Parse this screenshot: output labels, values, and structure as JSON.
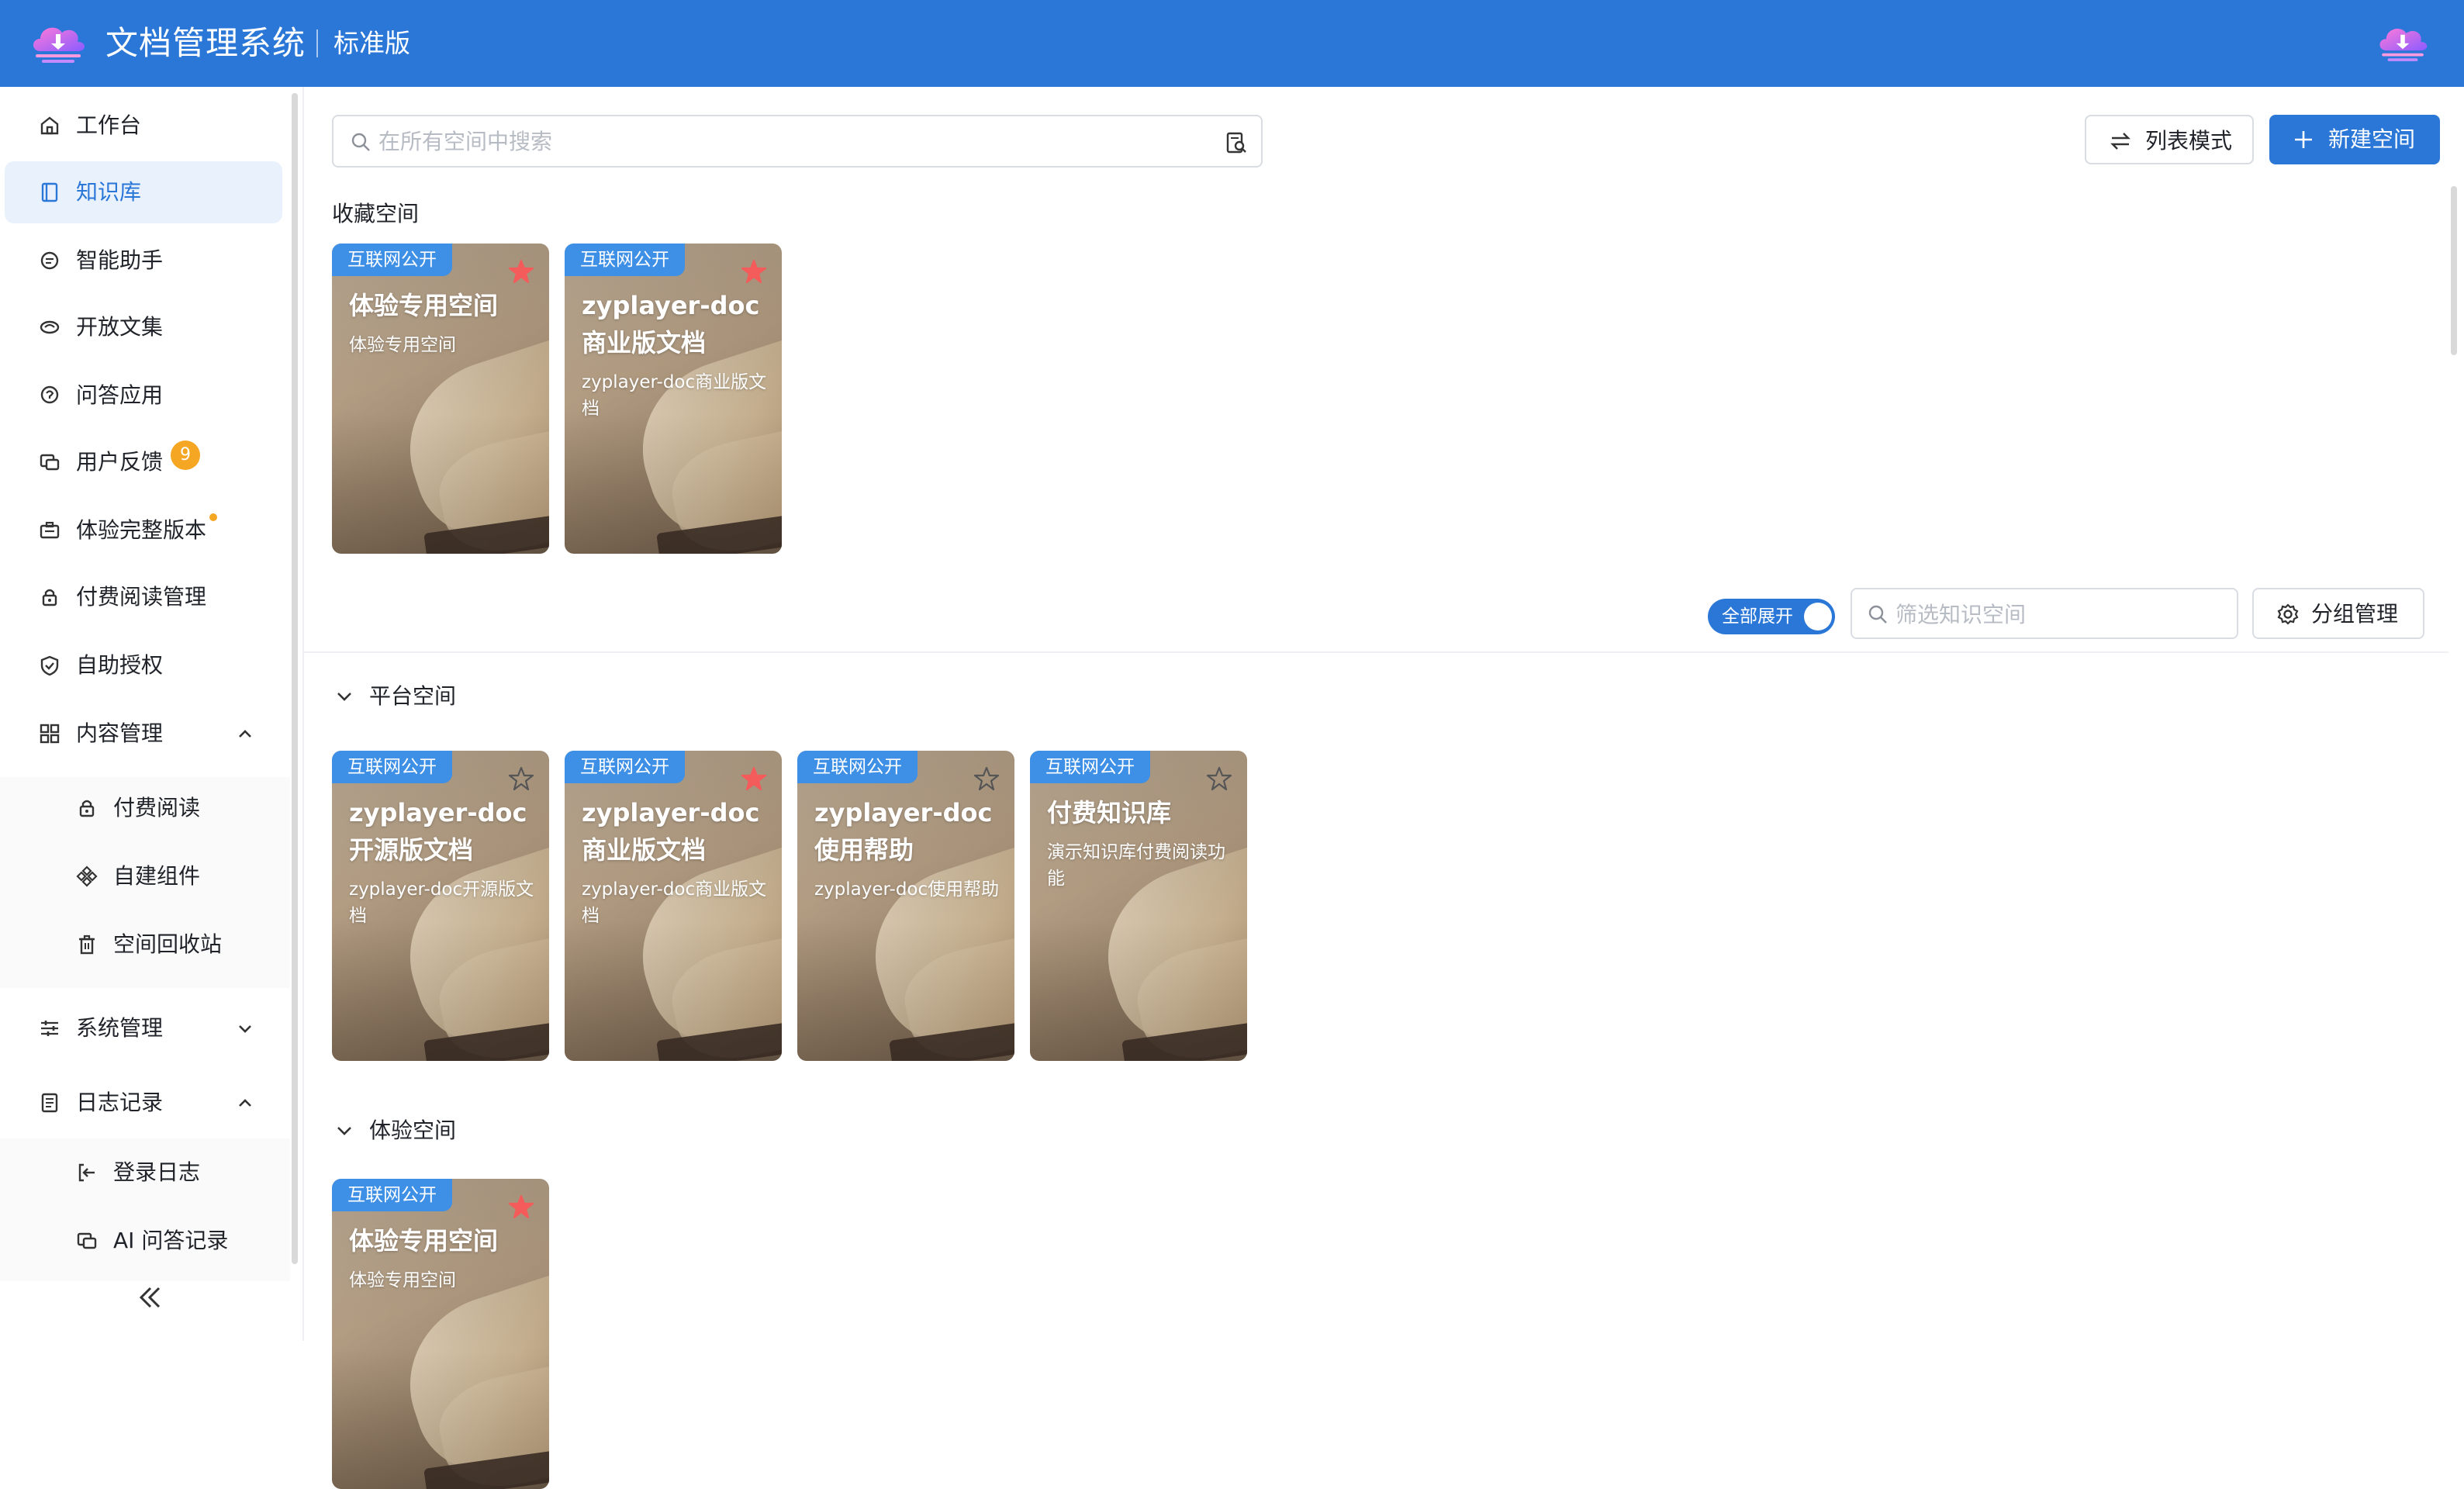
{
  "header": {
    "title": "文档管理系统",
    "edition": "标准版"
  },
  "sidebar": {
    "items": [
      {
        "label": "工作台",
        "icon": "home-icon"
      },
      {
        "label": "知识库",
        "icon": "book-icon"
      },
      {
        "label": "智能助手",
        "icon": "chat-icon"
      },
      {
        "label": "开放文集",
        "icon": "open-collection-icon"
      },
      {
        "label": "问答应用",
        "icon": "qa-icon"
      },
      {
        "label": "用户反馈",
        "icon": "feedback-icon",
        "badge": "9"
      },
      {
        "label": "体验完整版本",
        "icon": "briefcase-icon"
      },
      {
        "label": "付费阅读管理",
        "icon": "lock-icon"
      },
      {
        "label": "自助授权",
        "icon": "shield-icon"
      },
      {
        "label": "内容管理",
        "icon": "grid-icon"
      },
      {
        "label": "系统管理",
        "icon": "sliders-icon"
      },
      {
        "label": "日志记录",
        "icon": "log-icon"
      }
    ],
    "content_sub": [
      {
        "label": "付费阅读",
        "icon": "lock-icon"
      },
      {
        "label": "自建组件",
        "icon": "component-icon"
      },
      {
        "label": "空间回收站",
        "icon": "trash-icon"
      }
    ],
    "log_sub": [
      {
        "label": "登录日志",
        "icon": "login-icon"
      },
      {
        "label": "AI 问答记录",
        "icon": "ai-chat-icon"
      }
    ]
  },
  "toolbar": {
    "search_placeholder": "在所有空间中搜索",
    "list_mode_label": "列表模式",
    "new_space_label": "新建空间"
  },
  "favorites": {
    "title": "收藏空间",
    "cards": [
      {
        "tag": "互联网公开",
        "title": "体验专用空间",
        "desc": "体验专用空间",
        "starred": true
      },
      {
        "tag": "互联网公开",
        "title": "zyplayer-doc商业版文档",
        "desc": "zyplayer-doc商业版文档",
        "starred": true
      }
    ]
  },
  "filters": {
    "expand_all_label": "全部展开",
    "expand_all_on": true,
    "filter_placeholder": "筛选知识空间",
    "group_manage_label": "分组管理"
  },
  "groups": [
    {
      "title": "平台空间",
      "cards": [
        {
          "tag": "互联网公开",
          "title": "zyplayer-doc开源版文档",
          "desc": "zyplayer-doc开源版文档",
          "starred": false
        },
        {
          "tag": "互联网公开",
          "title": "zyplayer-doc商业版文档",
          "desc": "zyplayer-doc商业版文档",
          "starred": true
        },
        {
          "tag": "互联网公开",
          "title": "zyplayer-doc使用帮助",
          "desc": "zyplayer-doc使用帮助",
          "starred": false
        },
        {
          "tag": "互联网公开",
          "title": "付费知识库",
          "desc": "演示知识库付费阅读功能",
          "starred": false
        }
      ]
    },
    {
      "title": "体验空间",
      "cards": [
        {
          "tag": "互联网公开",
          "title": "体验专用空间",
          "desc": "体验专用空间",
          "starred": true
        }
      ]
    }
  ],
  "colors": {
    "primary": "#2a77d8",
    "tag_bg": "#3e8fe6",
    "star_active": "#f45b5b",
    "badge": "#f5a623"
  }
}
